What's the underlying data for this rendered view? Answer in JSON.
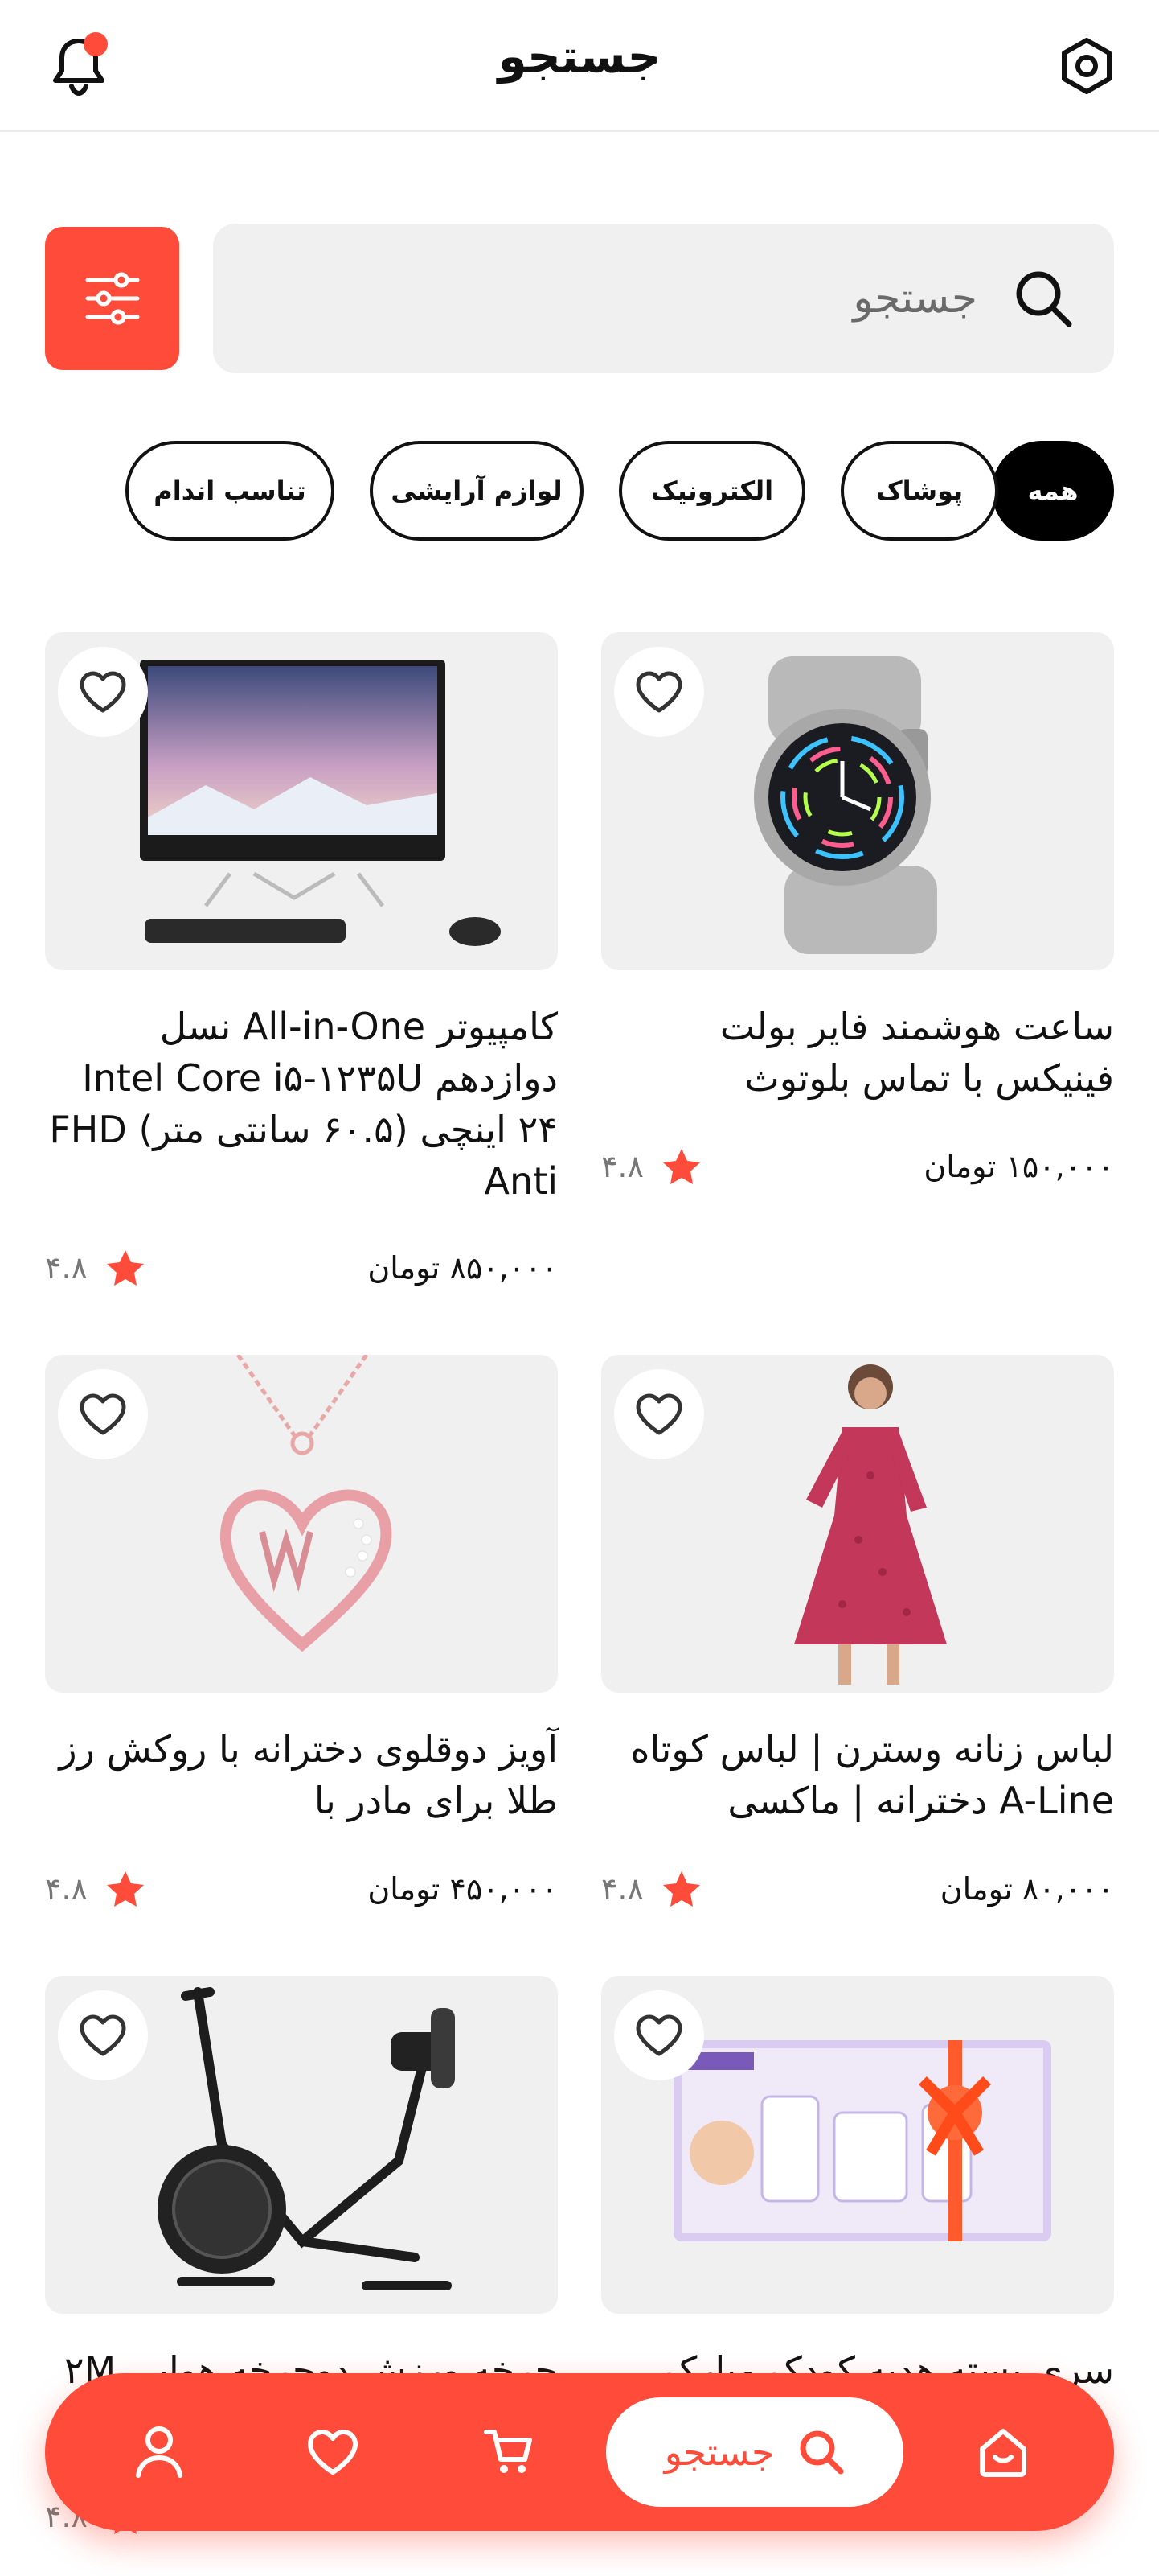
{
  "header": {
    "title": "جستجو",
    "icons": [
      "notification-bell-icon",
      "settings-icon"
    ],
    "notification_dot_color": "#ff4b3a"
  },
  "search": {
    "placeholder": "جستجو",
    "icon": "search-icon",
    "filter_icon": "sliders-icon",
    "accent": "#ff4b3a"
  },
  "categories": {
    "active_index": 0,
    "items": [
      {
        "label": "همه"
      },
      {
        "label": "پوشاک"
      },
      {
        "label": "الکترونیک"
      },
      {
        "label": "لوازم آرایشی"
      },
      {
        "label": "تناسب اندام"
      }
    ]
  },
  "products": [
    {
      "name": "ساعت هوشمند فایر بولت فینیکس با تماس بلوتوث",
      "price": "۱۵۰,۰۰۰ تومان",
      "rating": "۴.۸",
      "image": "smartwatch"
    },
    {
      "name": "کامپیوتر All-in-One نسل دوازدهم Intel Core i۵-۱۲۳۵U ۲۴ اینچی (۶۰.۵ سانتی متر) FHD Anti",
      "price": "۸۵۰,۰۰۰ تومان",
      "rating": "۴.۸",
      "image": "all-in-one-computer"
    },
    {
      "name": "لباس زنانه وسترن | لباس کوتاه A-Line دخترانه | ماکسی",
      "price": "۸۰,۰۰۰ تومان",
      "rating": "۴.۸",
      "image": "women-dress"
    },
    {
      "name": "آویز دوقلوی دخترانه با روکش رز طلا برای مادر با",
      "price": "۴۵۰,۰۰۰ تومان",
      "rating": "۴.۸",
      "image": "heart-pendant"
    },
    {
      "name": "سری بسته هدیه کودک مبارک",
      "price": "",
      "rating": "",
      "image": "baby-gift-pack"
    },
    {
      "name": "چرخه ورزش دوچرخه هوایی ۲M",
      "price": "",
      "rating": "۴.۸",
      "image": "exercise-bike"
    }
  ],
  "bottom_nav": {
    "active_label": "جستجو",
    "items": [
      "home-icon",
      "search-icon",
      "cart-icon",
      "heart-icon",
      "user-icon"
    ]
  },
  "colors": {
    "accent": "#ff4b3a",
    "card_bg": "#f0f0f0",
    "star": "#ff4b3a"
  }
}
